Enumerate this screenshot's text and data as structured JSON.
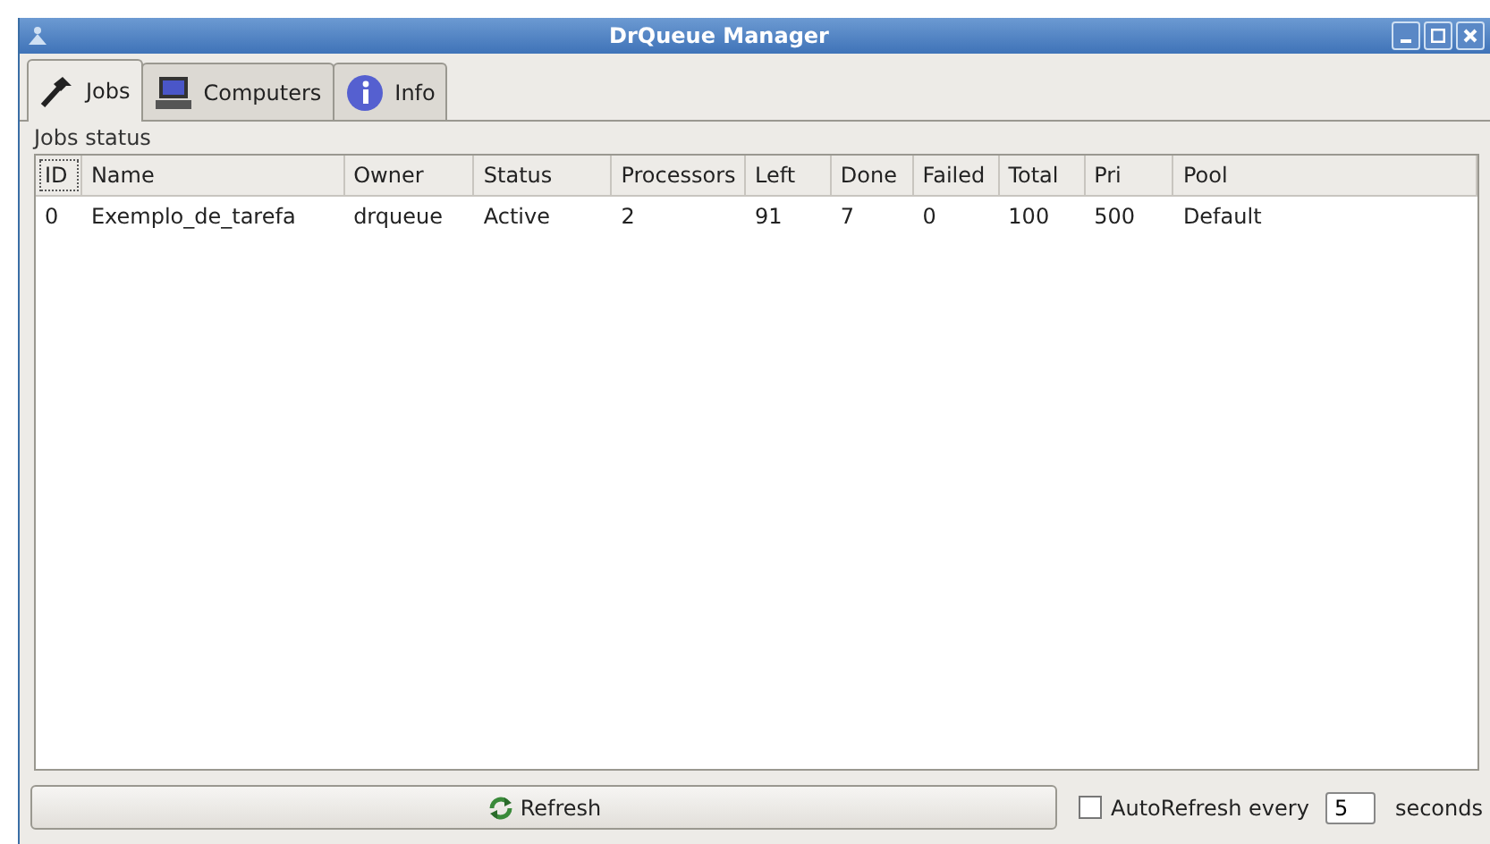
{
  "window": {
    "title": "DrQueue Manager"
  },
  "tabs": [
    {
      "label": "Jobs",
      "selected": true
    },
    {
      "label": "Computers",
      "selected": false
    },
    {
      "label": "Info",
      "selected": false
    }
  ],
  "group": {
    "title": "Jobs status"
  },
  "table": {
    "columns": [
      "ID",
      "Name",
      "Owner",
      "Status",
      "Processors",
      "Left",
      "Done",
      "Failed",
      "Total",
      "Pri",
      "Pool"
    ],
    "rows": [
      [
        "0",
        "Exemplo_de_tarefa",
        "drqueue",
        "Active",
        "2",
        "91",
        "7",
        "0",
        "100",
        "500",
        "Default"
      ]
    ]
  },
  "refresh_button": {
    "label": "Refresh"
  },
  "autorefresh": {
    "label": "AutoRefresh every",
    "checked": false,
    "value": "5",
    "unit": "seconds"
  }
}
